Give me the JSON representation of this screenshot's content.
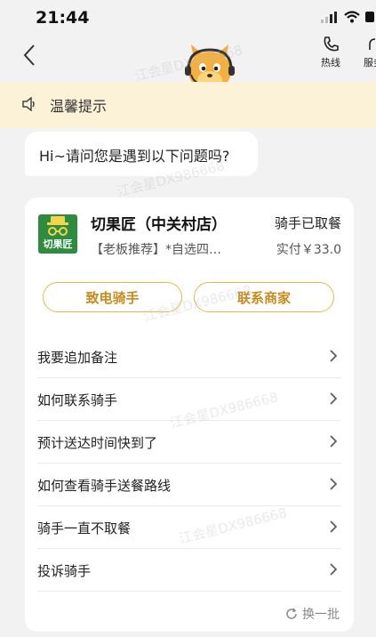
{
  "status_bar": {
    "time": "21:44"
  },
  "header": {
    "hotline_label": "热线",
    "service_label": "服务"
  },
  "notice": {
    "text": "温馨提示"
  },
  "greeting": {
    "text": "Hi~请问您是遇到以下问题吗?"
  },
  "order": {
    "store_name": "切果匠（中关村店）",
    "status": "骑手已取餐",
    "desc": "【老板推荐】*自选四…",
    "paid": "实付￥33.0",
    "logo_text": "切果匠"
  },
  "actions": {
    "call_rider": "致电骑手",
    "contact_merchant": "联系商家"
  },
  "faq": [
    {
      "label": "我要追加备注"
    },
    {
      "label": "如何联系骑手"
    },
    {
      "label": "预计送达时间快到了"
    },
    {
      "label": "如何查看骑手送餐路线"
    },
    {
      "label": "骑手一直不取餐"
    },
    {
      "label": "投诉骑手"
    }
  ],
  "refresh": {
    "label": "换一批"
  },
  "watermark": "江会星DX986668",
  "colors": {
    "accent": "#e9b84a",
    "accent_text": "#c98a1c",
    "notice_bg": "#fbf2d8",
    "logo_bg": "#2f8c3e"
  }
}
